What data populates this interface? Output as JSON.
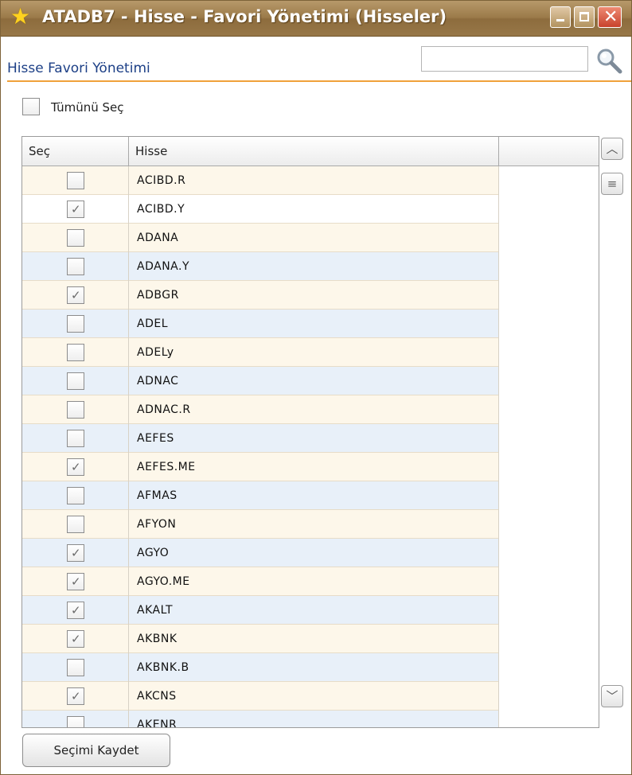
{
  "window": {
    "title": "ATADB7 - Hisse - Favori Yönetimi (Hisseler)",
    "icon": "star-icon",
    "controls": [
      "minimize-icon",
      "maximize-icon",
      "close-icon"
    ]
  },
  "header": {
    "title": "Hisse Favori Yönetimi",
    "search_value": "",
    "search_icon": "magnifier-icon"
  },
  "select_all": {
    "label": "Tümünü Seç",
    "checked": false
  },
  "grid": {
    "columns": [
      "Seç",
      "Hisse",
      ""
    ],
    "rows": [
      {
        "checked": false,
        "hisse": "ACIBD.R"
      },
      {
        "checked": true,
        "hisse": "ACIBD.Y"
      },
      {
        "checked": false,
        "hisse": "ADANA"
      },
      {
        "checked": false,
        "hisse": "ADANA.Y"
      },
      {
        "checked": true,
        "hisse": "ADBGR"
      },
      {
        "checked": false,
        "hisse": "ADEL"
      },
      {
        "checked": false,
        "hisse": "ADELy"
      },
      {
        "checked": false,
        "hisse": "ADNAC"
      },
      {
        "checked": false,
        "hisse": "ADNAC.R"
      },
      {
        "checked": false,
        "hisse": "AEFES"
      },
      {
        "checked": true,
        "hisse": "AEFES.ME"
      },
      {
        "checked": false,
        "hisse": "AFMAS"
      },
      {
        "checked": false,
        "hisse": "AFYON"
      },
      {
        "checked": true,
        "hisse": "AGYO"
      },
      {
        "checked": true,
        "hisse": "AGYO.ME"
      },
      {
        "checked": true,
        "hisse": "AKALT"
      },
      {
        "checked": true,
        "hisse": "AKBNK"
      },
      {
        "checked": false,
        "hisse": "AKBNK.B"
      },
      {
        "checked": true,
        "hisse": "AKCNS"
      },
      {
        "checked": false,
        "hisse": "AKENR"
      }
    ]
  },
  "scrollbar": {
    "up_icon": "chevron-up-icon",
    "thumb_icon": "grip-icon",
    "down_icon": "chevron-down-icon"
  },
  "footer": {
    "save_label": "Seçimi Kaydet"
  },
  "colors": {
    "title_bar": "#9b7a49",
    "accent_rule": "#f0a13a",
    "header_text": "#1c3f86",
    "row_odd": "#fdf7ea",
    "row_even": "#e8f0f9",
    "close_button": "#c8422c"
  }
}
